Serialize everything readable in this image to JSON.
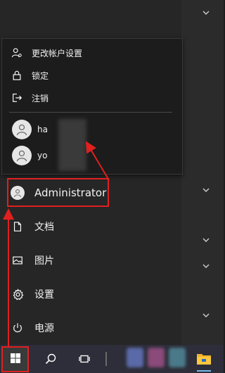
{
  "flyout": {
    "items": [
      {
        "label": "更改帐户设置",
        "icon": "person-settings-icon"
      },
      {
        "label": "锁定",
        "icon": "lock-icon"
      },
      {
        "label": "注销",
        "icon": "sign-out-icon"
      }
    ],
    "users": [
      {
        "label": "ha",
        "icon": "user-avatar-icon"
      },
      {
        "label": "yo",
        "icon": "user-avatar-icon"
      }
    ]
  },
  "menu": {
    "user": {
      "label": "Administrator",
      "icon": "user-avatar-icon"
    },
    "items": [
      {
        "label": "文档",
        "icon": "document-icon"
      },
      {
        "label": "图片",
        "icon": "picture-icon"
      },
      {
        "label": "设置",
        "icon": "gear-icon"
      },
      {
        "label": "电源",
        "icon": "power-icon"
      }
    ]
  },
  "taskbar": {
    "icons": [
      "windows-start-icon",
      "search-icon",
      "task-view-icon",
      "file-explorer-icon"
    ]
  },
  "colors": {
    "annotation_red": "#e0201f",
    "menu_background": "#262626",
    "flyout_background": "#1c1c1c",
    "taskbar_background": "#2e2e3a"
  }
}
